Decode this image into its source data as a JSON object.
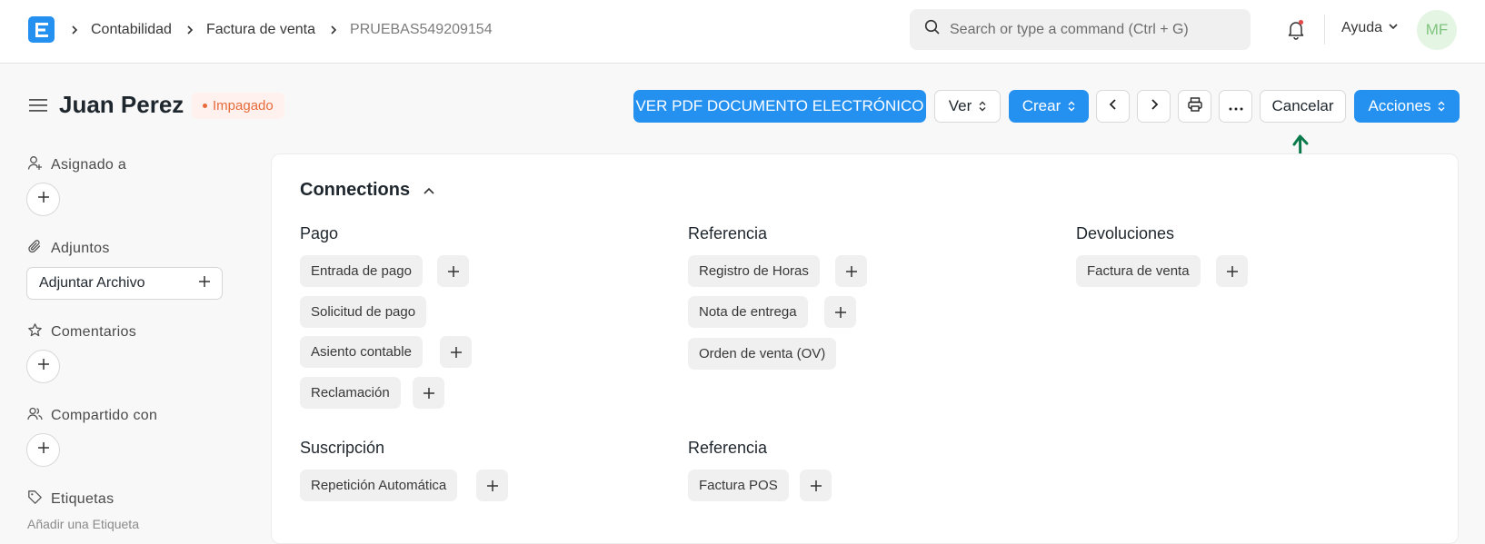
{
  "navbar": {
    "logo_letter": "E",
    "breadcrumbs": [
      "Contabilidad",
      "Factura de venta",
      "PRUEBAS549209154"
    ],
    "search_placeholder": "Search or type a command (Ctrl + G)",
    "help_label": "Ayuda",
    "avatar_initials": "MF"
  },
  "page": {
    "title": "Juan Perez",
    "status": "Impagado",
    "actions": {
      "pdf_label": "VER PDF DOCUMENTO ELECTRÓNICO",
      "view_label": "Ver",
      "create_label": "Crear",
      "cancel_label": "Cancelar",
      "actions_label": "Acciones"
    }
  },
  "sidebar": {
    "assigned_label": "Asignado a",
    "attachments_label": "Adjuntos",
    "attach_button_label": "Adjuntar Archivo",
    "comments_label": "Comentarios",
    "shared_label": "Compartido con",
    "tags_label": "Etiquetas",
    "tags_add_label": "Añadir una Etiqueta"
  },
  "connections": {
    "title": "Connections",
    "groups": [
      {
        "title": "Pago",
        "items": [
          "Entrada de pago",
          "Solicitud de pago",
          "Asiento contable",
          "Reclamación"
        ]
      },
      {
        "title": "Referencia",
        "items": [
          "Registro de Horas",
          "Nota de entrega",
          "Orden de venta (OV)"
        ]
      },
      {
        "title": "Devoluciones",
        "items": [
          "Factura de venta"
        ]
      },
      {
        "title": "Suscripción",
        "items": [
          "Repetición Automática"
        ]
      },
      {
        "title": "Referencia",
        "items": [
          "Factura POS"
        ]
      }
    ]
  },
  "colors": {
    "primary": "#2490ef",
    "status_unpaid": "#e66a3a",
    "annotation_arrow": "#0b7a4b"
  }
}
